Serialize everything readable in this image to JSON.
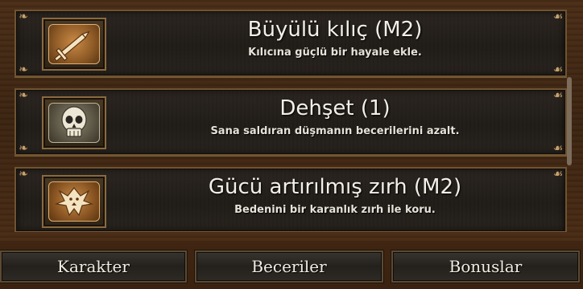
{
  "abilities": [
    {
      "icon": "sword-icon",
      "title": "Büyülü kılıç (M2)",
      "description": "Kılıcına güçlü bir hayale ekle."
    },
    {
      "icon": "skull-icon",
      "title": "Dehşet (1)",
      "description": "Sana saldıran düşmanın becerilerini azalt."
    },
    {
      "icon": "wolf-emblem-icon",
      "title": "Gücü artırılmış zırh (M2)",
      "description": "Bedenini bir karanlık zırh ile koru."
    }
  ],
  "tabs": {
    "character": "Karakter",
    "skills": "Beceriler",
    "bonuses": "Bonuslar"
  },
  "colors": {
    "frame_gold": "#8a6a3e",
    "card_bg": "#1e1a16",
    "text": "#f2efe8"
  }
}
